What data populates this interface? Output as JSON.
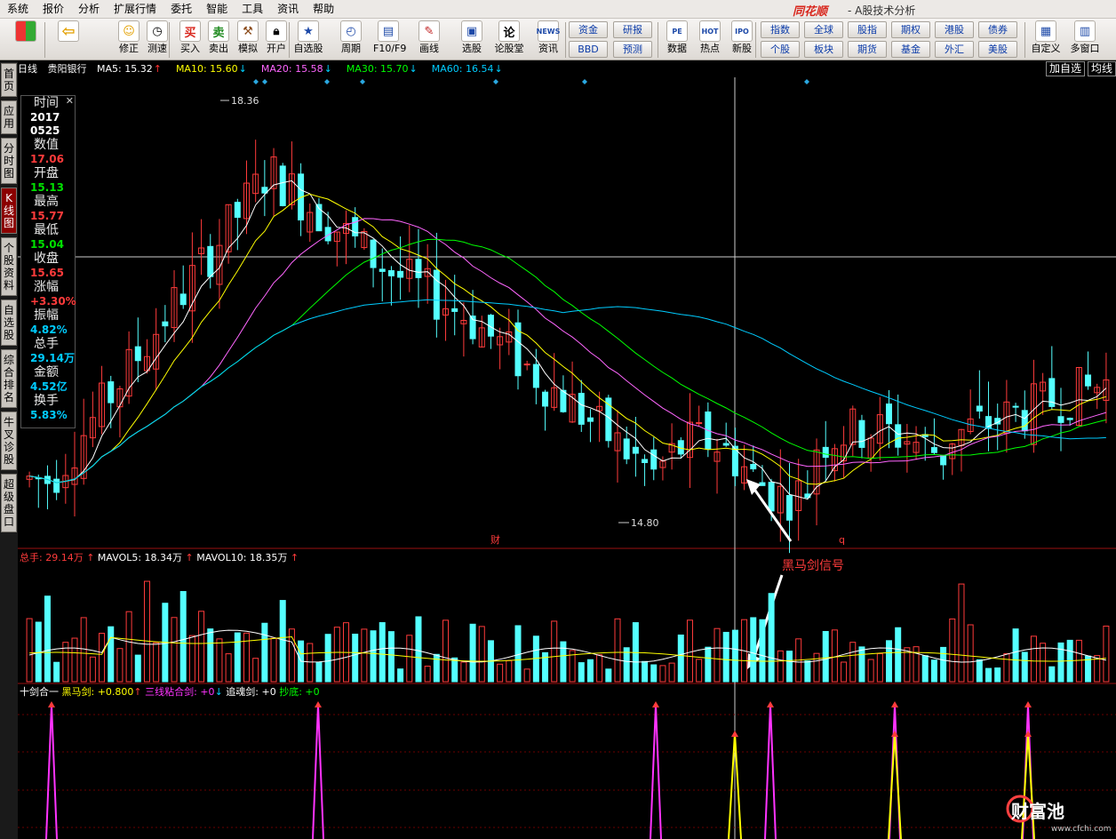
{
  "menu": [
    "系统",
    "报价",
    "分析",
    "扩展行情",
    "委托",
    "智能",
    "工具",
    "资讯",
    "帮助"
  ],
  "app": {
    "logo": "同花顺",
    "subtitle": "- A股技术分析"
  },
  "toolbar": {
    "buttons": [
      {
        "label": "",
        "icon": "windows-icon"
      },
      {
        "label": "",
        "icon": "back-arrow-icon"
      },
      {
        "label": "修正",
        "icon": "revise-icon"
      },
      {
        "label": "测速",
        "icon": "speed-test-icon"
      },
      {
        "label": "买入",
        "icon": "buy-icon",
        "glyph": "买"
      },
      {
        "label": "卖出",
        "icon": "sell-icon",
        "glyph": "卖"
      },
      {
        "label": "模拟",
        "icon": "hammer-icon"
      },
      {
        "label": "开户",
        "icon": "lock-icon"
      },
      {
        "label": "自选股",
        "icon": "star-icon"
      },
      {
        "label": "周期",
        "icon": "clock-icon"
      },
      {
        "label": "F10/F9",
        "icon": "f10-icon"
      },
      {
        "label": "画线",
        "icon": "pen-icon"
      },
      {
        "label": "选股",
        "icon": "monitor-icon"
      },
      {
        "label": "论股堂",
        "icon": "forum-icon",
        "glyph": "论"
      },
      {
        "label": "资讯",
        "icon": "news-icon",
        "glyph": "NEWS"
      },
      {
        "label": "数据",
        "icon": "pe-icon",
        "glyph": "PE"
      },
      {
        "label": "热点",
        "icon": "hot-icon",
        "glyph": "HOT"
      },
      {
        "label": "新股",
        "icon": "ipo-icon",
        "glyph": "IPO"
      },
      {
        "label": "自定义",
        "icon": "custom-icon"
      },
      {
        "label": "多窗口",
        "icon": "multi-window-icon"
      }
    ],
    "small_buttons": [
      [
        "资金",
        "研报"
      ],
      [
        "BBD",
        "预测"
      ],
      [
        "指数",
        "全球",
        "股指",
        "期权",
        "港股",
        "债券"
      ],
      [
        "个股",
        "板块",
        "期货",
        "基金",
        "外汇",
        "美股"
      ]
    ]
  },
  "left_tabs": [
    "首页",
    "应用",
    "分时图",
    "K线图",
    "个股资料",
    "自选股",
    "综合排名",
    "牛叉诊股",
    "超级盘口"
  ],
  "header": {
    "period": "日线",
    "stock": "贵阳银行",
    "ma": [
      {
        "label": "MA5: 15.32",
        "color": "#ffffff",
        "arrow": "↑",
        "arrow_color": "#ff3030"
      },
      {
        "label": "MA10: 15.60",
        "color": "#ffff00",
        "arrow": "↓",
        "arrow_color": "#00d0ff"
      },
      {
        "label": "MA20: 15.58",
        "color": "#ff66ff",
        "arrow": "↓",
        "arrow_color": "#00d0ff"
      },
      {
        "label": "MA30: 15.70",
        "color": "#00ff00",
        "arrow": "↓",
        "arrow_color": "#00d0ff"
      },
      {
        "label": "MA60: 16.54",
        "color": "#00ccff",
        "arrow": "↓",
        "arrow_color": "#00d0ff"
      }
    ],
    "right_buttons": [
      "加自选",
      "均线"
    ]
  },
  "info_panel": {
    "rows": [
      {
        "label": "时间"
      },
      {
        "value": "2017",
        "color": "#ffffff"
      },
      {
        "value": "0525",
        "color": "#ffffff"
      },
      {
        "label": "数值"
      },
      {
        "value": "17.06",
        "color": "#ff3b3b"
      },
      {
        "label": "开盘"
      },
      {
        "value": "15.13",
        "color": "#00e000"
      },
      {
        "label": "最高"
      },
      {
        "value": "15.77",
        "color": "#ff3b3b"
      },
      {
        "label": "最低"
      },
      {
        "value": "15.04",
        "color": "#00e000"
      },
      {
        "label": "收盘"
      },
      {
        "value": "15.65",
        "color": "#ff3b3b"
      },
      {
        "label": "涨幅"
      },
      {
        "value": "+3.30%",
        "color": "#ff3b3b"
      },
      {
        "label": "振幅"
      },
      {
        "value": "4.82%",
        "color": "#00ccff"
      },
      {
        "label": "总手"
      },
      {
        "value": "29.14万",
        "color": "#00ccff"
      },
      {
        "label": "金额"
      },
      {
        "value": "4.52亿",
        "color": "#00ccff"
      },
      {
        "label": "换手"
      },
      {
        "value": "5.83%",
        "color": "#00ccff"
      }
    ],
    "close": "✕"
  },
  "price_chart": {
    "high_label": "18.36",
    "low_label": "14.80",
    "marker_cai": "财",
    "marker_q": "q",
    "annotation": "黑马剑信号"
  },
  "volume_header": [
    {
      "label": "总手: 29.14万",
      "color": "#ff3b3b",
      "arrow": "↑"
    },
    {
      "label": "MAVOL5: 18.34万",
      "color": "#ffffff",
      "arrow": "↑"
    },
    {
      "label": "MAVOL10: 18.35万",
      "color": "#ffffff",
      "arrow": "↑"
    }
  ],
  "indicator_header": [
    {
      "label": "十剑合一",
      "color": "#ffffff",
      "arrow": ""
    },
    {
      "label": "黑马剑: +0.800",
      "color": "#ffff00",
      "arrow": "↑"
    },
    {
      "label": "三线粘合剑: +0",
      "color": "#ff33ff",
      "arrow": "↓"
    },
    {
      "label": "追魂剑: +0",
      "color": "#ffffff",
      "arrow": ""
    },
    {
      "label": "抄底: +0",
      "color": "#00ff00",
      "arrow": ""
    }
  ],
  "watermark": {
    "brand": "财富池",
    "url": "www.cfchi.com"
  },
  "colors": {
    "up": "#ff3b3b",
    "down": "#54ffff",
    "ma5": "#ffffff",
    "ma10": "#ffff00",
    "ma20": "#ff66ff",
    "ma30": "#00ff00",
    "ma60": "#00ccff"
  }
}
